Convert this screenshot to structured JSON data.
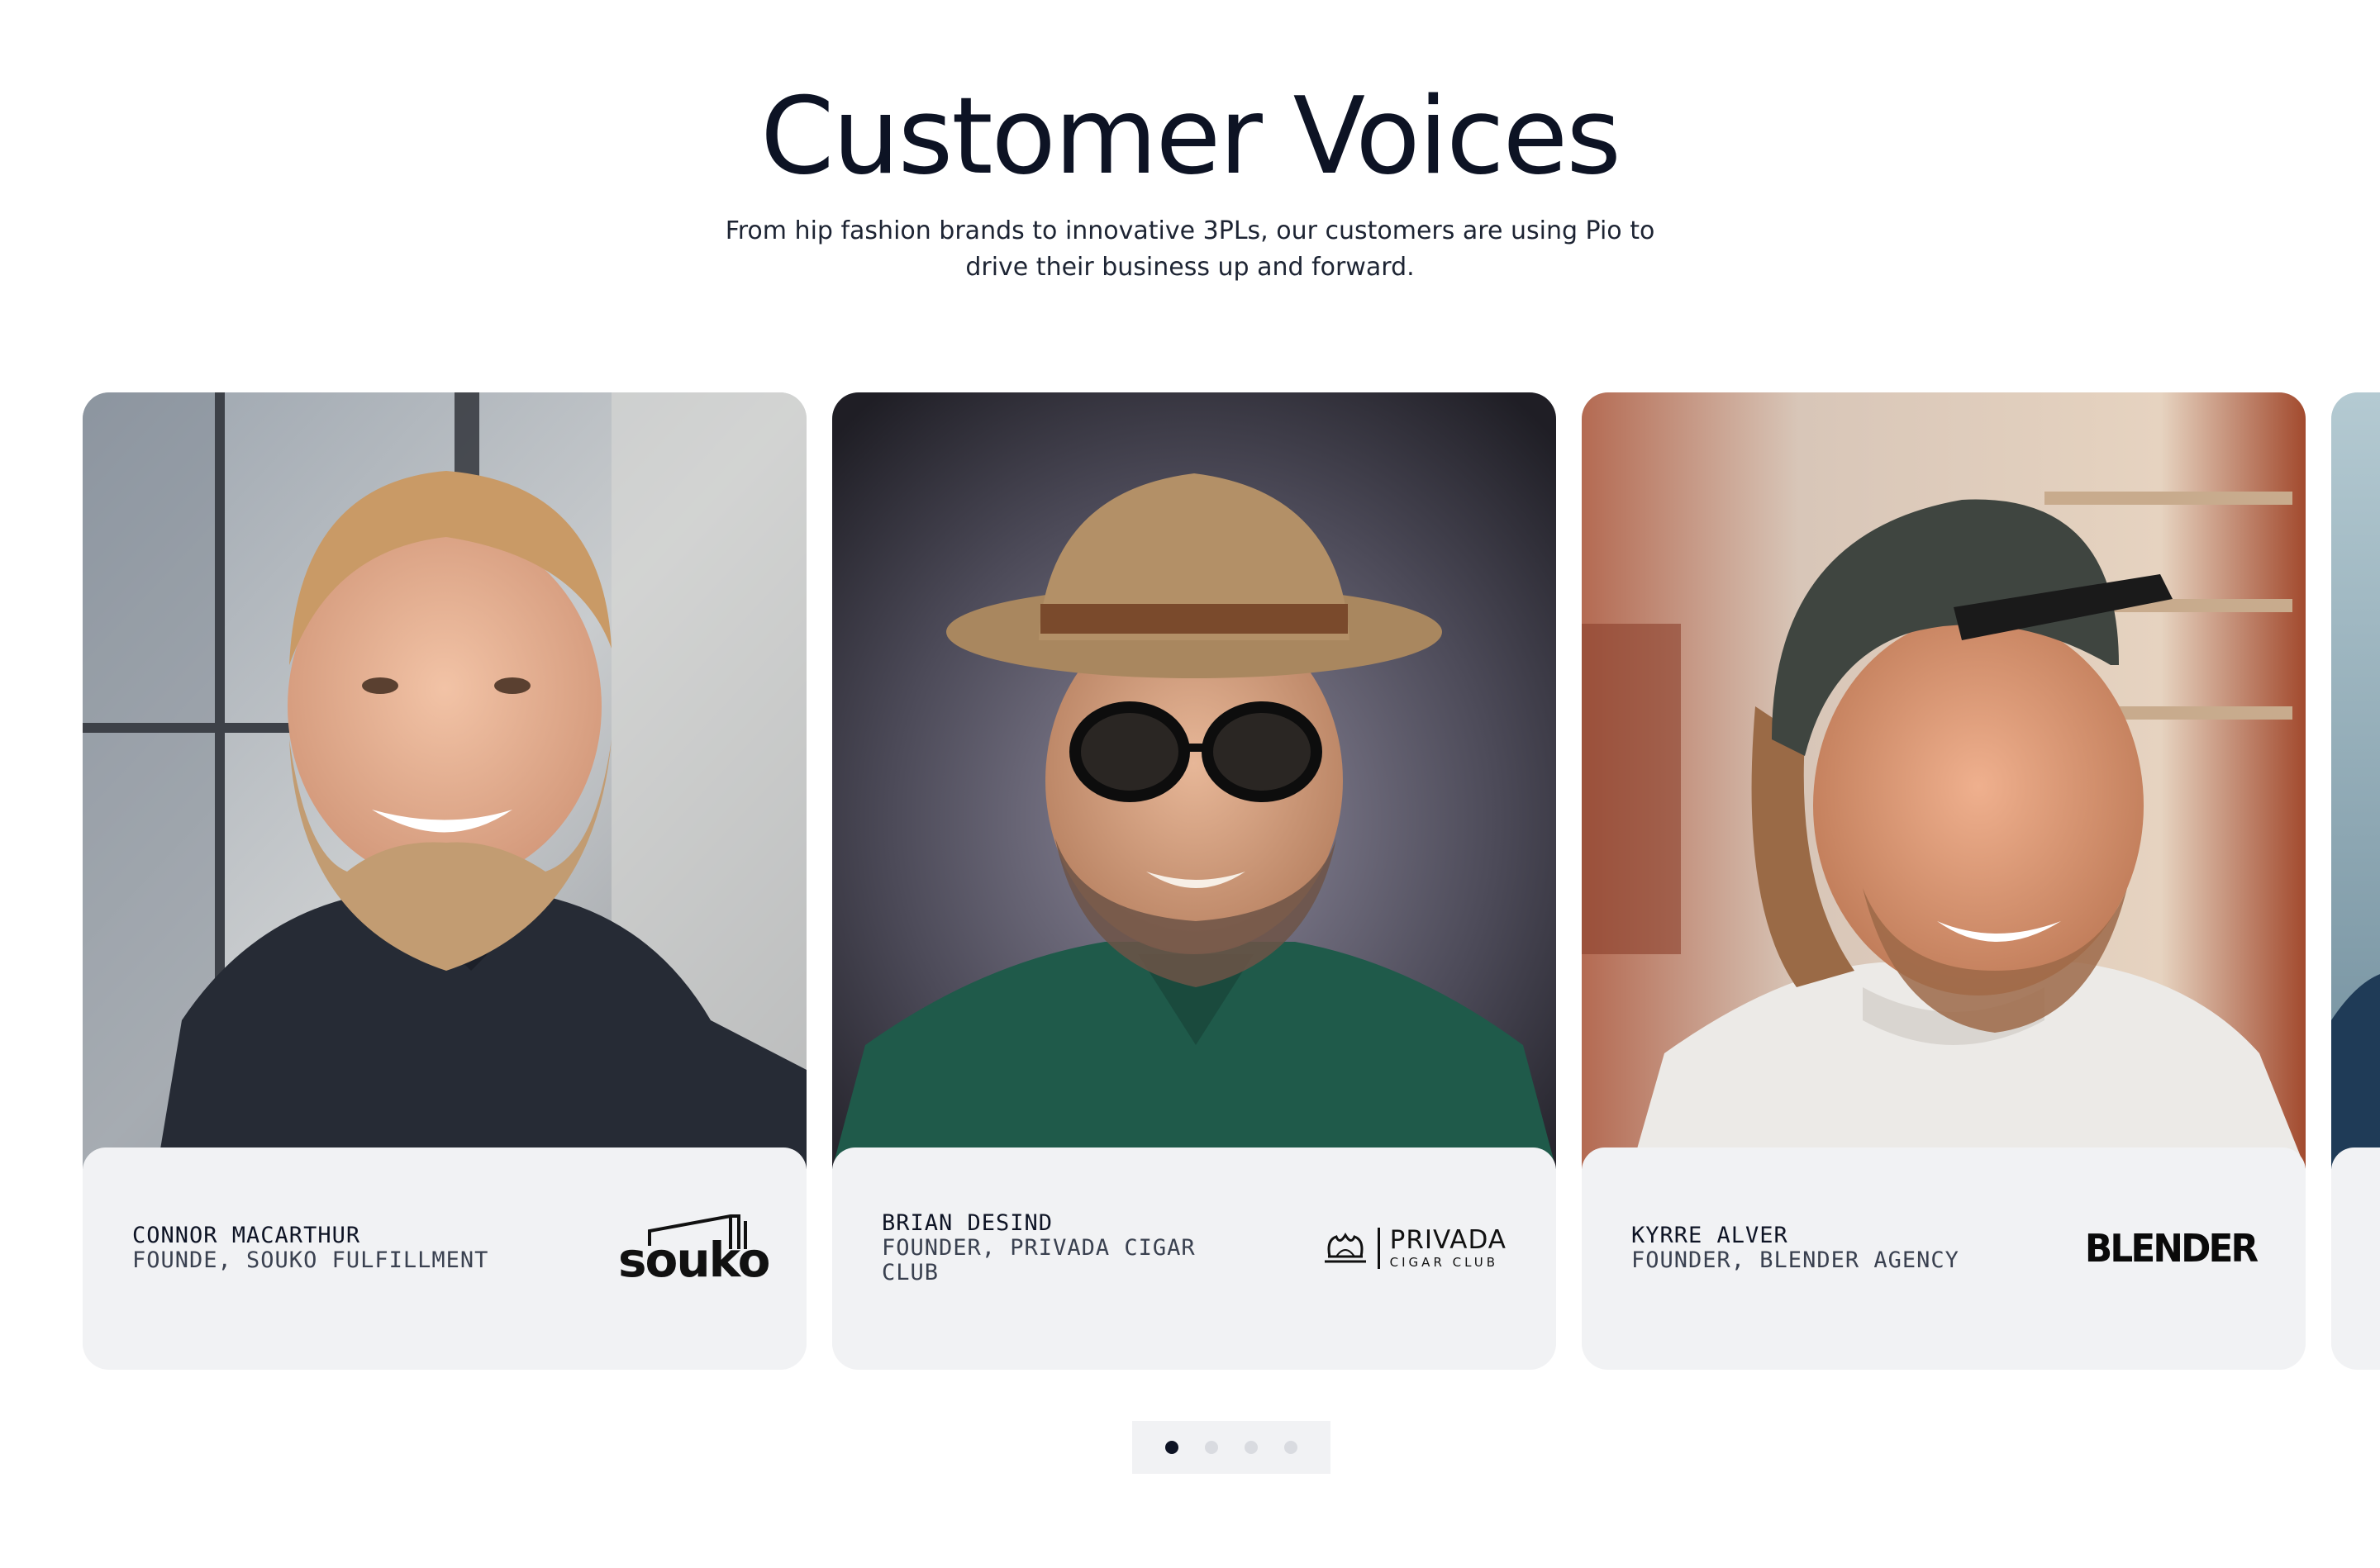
{
  "section": {
    "title": "Customer Voices",
    "subtitle": "From hip fashion brands to innovative 3PLs, our customers are using Pio to drive their business up and forward."
  },
  "testimonials": [
    {
      "name": "CONNOR MACARTHUR",
      "role": "FOUNDE, SOUKO FULFILLMENT",
      "logo_text": "souko",
      "photo_alt": "Bearded man in dark polo shirt smiling"
    },
    {
      "name": "BRIAN DESIND",
      "role": "FOUNDER, PRIVADA CIGAR CLUB",
      "logo_text": "PRIVADA",
      "logo_subtext": "CIGAR CLUB",
      "photo_alt": "Man wearing tan fedora and black glasses"
    },
    {
      "name": "KYRRE ALVER",
      "role": "FOUNDER, BLENDER AGENCY",
      "logo_text": "BLENDER",
      "photo_alt": "Smiling man in backwards cap"
    }
  ],
  "pagination": {
    "total": 4,
    "active_index": 0
  },
  "colors": {
    "heading": "#0d1324",
    "caption_bg": "#f1f2f4",
    "dot_inactive": "#d9dbe0",
    "dot_active": "#0d1324"
  }
}
